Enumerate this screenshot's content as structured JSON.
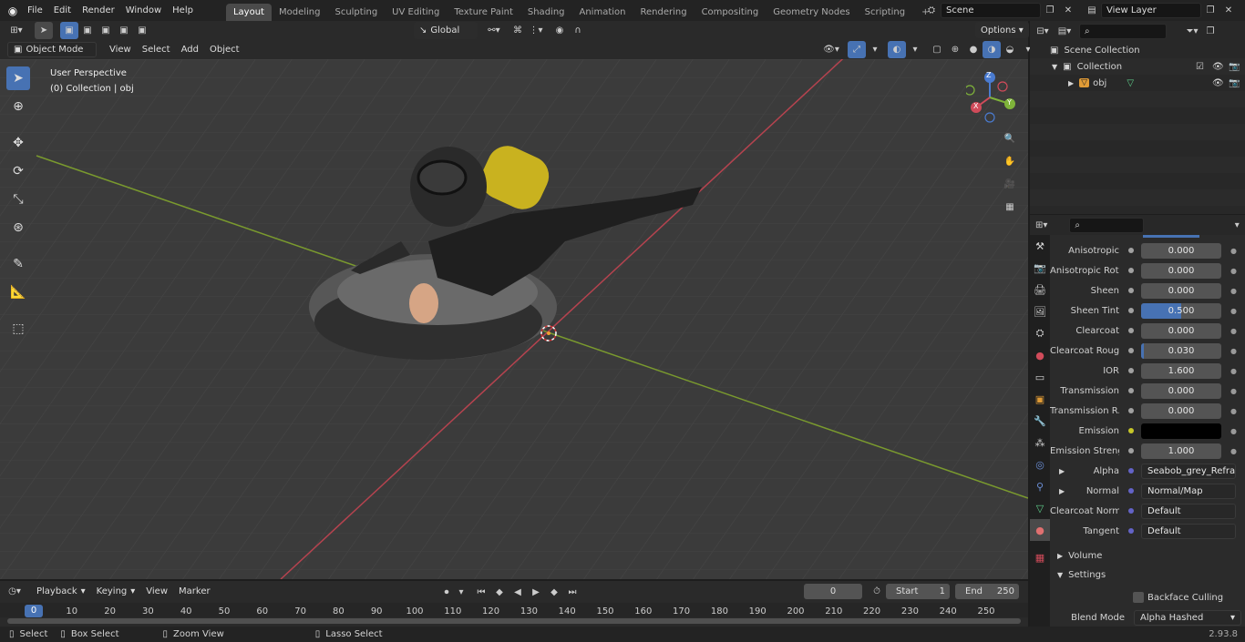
{
  "menubar": {
    "items": [
      "File",
      "Edit",
      "Render",
      "Window",
      "Help"
    ],
    "workspaces": [
      "Layout",
      "Modeling",
      "Sculpting",
      "UV Editing",
      "Texture Paint",
      "Shading",
      "Animation",
      "Rendering",
      "Compositing",
      "Geometry Nodes",
      "Scripting"
    ],
    "active_workspace": "Layout",
    "add_tab": "+",
    "scene": "Scene",
    "view_layer": "View Layer"
  },
  "viewport_header": {
    "mode": "Object Mode",
    "menus": [
      "View",
      "Select",
      "Add",
      "Object"
    ],
    "transform_orientation": "Global",
    "options": "Options"
  },
  "viewport": {
    "perspective": "User Perspective",
    "collection_info": "(0) Collection | obj",
    "axes": {
      "x": "X",
      "y": "Y",
      "z": "Z"
    }
  },
  "outliner": {
    "scene_collection": "Scene Collection",
    "collection": "Collection",
    "object": "obj"
  },
  "properties": {
    "rows": [
      {
        "label": "Anisotropic",
        "value": "0.000",
        "kind": "num",
        "fill": 0
      },
      {
        "label": "Anisotropic Rot...",
        "value": "0.000",
        "kind": "num",
        "fill": 0
      },
      {
        "label": "Sheen",
        "value": "0.000",
        "kind": "num",
        "fill": 0
      },
      {
        "label": "Sheen Tint",
        "value": "0.500",
        "kind": "num",
        "fill": 0.5
      },
      {
        "label": "Clearcoat",
        "value": "0.000",
        "kind": "num",
        "fill": 0
      },
      {
        "label": "Clearcoat Roug...",
        "value": "0.030",
        "kind": "num",
        "fill": 0.03
      },
      {
        "label": "IOR",
        "value": "1.600",
        "kind": "num",
        "fill": 0
      },
      {
        "label": "Transmission",
        "value": "0.000",
        "kind": "num",
        "fill": 0
      },
      {
        "label": "Transmission R...",
        "value": "0.000",
        "kind": "num",
        "fill": 0
      },
      {
        "label": "Emission",
        "value": "",
        "kind": "color"
      },
      {
        "label": "Emission Strengt",
        "value": "1.000",
        "kind": "num",
        "fill": 0
      },
      {
        "label": "Alpha",
        "value": "Seabob_grey_Refra...",
        "kind": "link"
      },
      {
        "label": "Normal",
        "value": "Normal/Map",
        "kind": "link"
      },
      {
        "label": "Clearcoat Normal",
        "value": "Default",
        "kind": "link"
      },
      {
        "label": "Tangent",
        "value": "Default",
        "kind": "link"
      }
    ],
    "volume": "Volume",
    "settings": "Settings",
    "backface_culling": "Backface Culling",
    "blend_mode_label": "Blend Mode",
    "blend_mode_value": "Alpha Hashed",
    "accent": "#4772b3"
  },
  "timeline": {
    "menus": [
      "Playback",
      "Keying",
      "View",
      "Marker"
    ],
    "current_frame": "0",
    "start_label": "Start",
    "start_value": "1",
    "end_label": "End",
    "end_value": "250",
    "ticks": [
      "0",
      "10",
      "20",
      "30",
      "40",
      "50",
      "60",
      "70",
      "80",
      "90",
      "100",
      "110",
      "120",
      "130",
      "140",
      "150",
      "160",
      "170",
      "180",
      "190",
      "200",
      "210",
      "220",
      "230",
      "240",
      "250"
    ]
  },
  "statusbar": {
    "select": "Select",
    "box_select": "Box Select",
    "zoom_view": "Zoom View",
    "lasso_select": "Lasso Select",
    "version": "2.93.8"
  }
}
